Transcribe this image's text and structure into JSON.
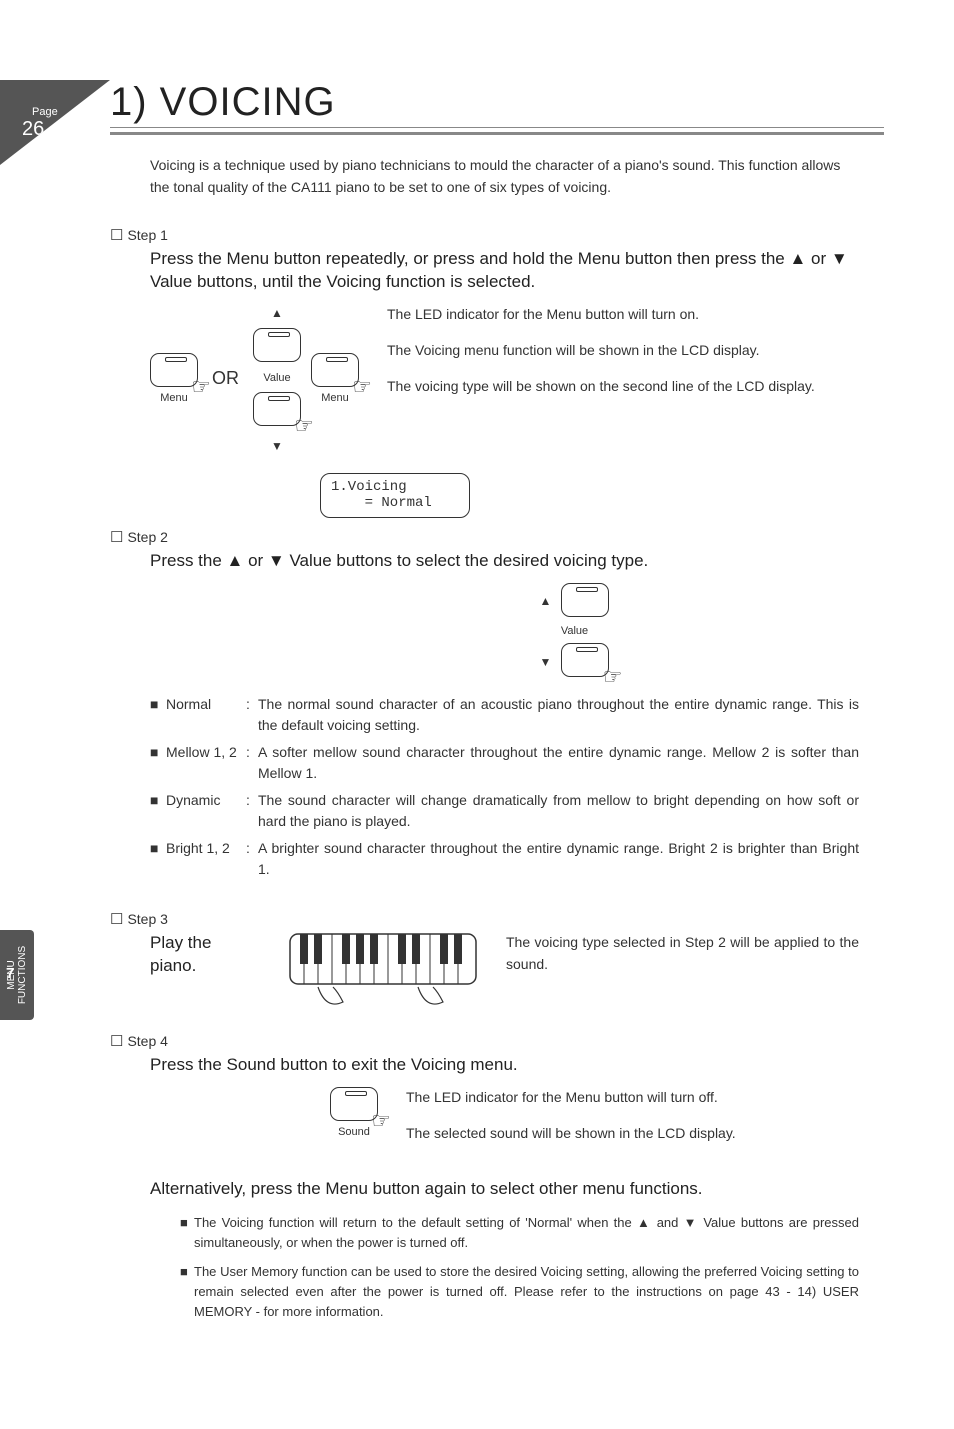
{
  "page_label": "Page",
  "page_number": "26",
  "title": "1) VOICING",
  "intro": "Voicing is a technique used by piano technicians to mould the character of a piano's sound. This function allows the tonal quality of the CA111 piano to be set to one of six types of voicing.",
  "step1": {
    "label": "Step 1",
    "text": "Press the Menu button repeatedly, or press and hold the Menu button then press the ▲ or ▼ Value buttons, until the Voicing function is selected.",
    "or": "OR",
    "menu_label": "Menu",
    "value_label": "Value",
    "lcd_line1": "1.Voicing",
    "lcd_line2": "    = Normal",
    "note1": "The LED indicator for the Menu button will turn on.",
    "note2": "The Voicing menu function will be shown in the LCD display.",
    "note3": "The voicing type will be shown on the second line of the LCD display."
  },
  "step2": {
    "label": "Step 2",
    "text": "Press the ▲ or ▼ Value buttons to select the desired voicing type.",
    "value_label": "Value",
    "types": [
      {
        "name": "Normal",
        "desc": "The normal sound character of an acoustic piano throughout the entire dynamic range. This is the default voicing setting."
      },
      {
        "name": "Mellow 1, 2",
        "desc": "A softer mellow sound character throughout the entire dynamic range. Mellow 2 is softer than Mellow 1."
      },
      {
        "name": "Dynamic",
        "desc": "The sound character will change dramatically from mellow to bright depending on how soft or hard the piano is played."
      },
      {
        "name": "Bright 1, 2",
        "desc": "A brighter sound character throughout the entire dynamic range.  Bright 2 is brighter than Bright 1."
      }
    ]
  },
  "step3": {
    "label": "Step 3",
    "text": "Play the piano.",
    "note": "The voicing type selected in Step 2 will be applied to the sound."
  },
  "step4": {
    "label": "Step 4",
    "text": "Press the Sound button to exit the Voicing menu.",
    "sound_label": "Sound",
    "note1": "The LED indicator for the Menu button will turn off.",
    "note2": "The selected sound will be shown in the LCD display."
  },
  "alt_text": "Alternatively, press the Menu button again to select other menu functions.",
  "footnotes": [
    "The Voicing function will return to the default setting of 'Normal' when the ▲ and ▼ Value buttons are pressed simultaneously, or when the power is turned off.",
    "The User Memory function can be used to store the desired Voicing setting, allowing the preferred Voicing setting to remain selected even after the power is turned off.  Please refer to the instructions on page 43 - 14) USER MEMORY - for more information."
  ],
  "sidetab": {
    "num": "7",
    "line1": "MENU",
    "line2": "FUNCTIONS"
  }
}
